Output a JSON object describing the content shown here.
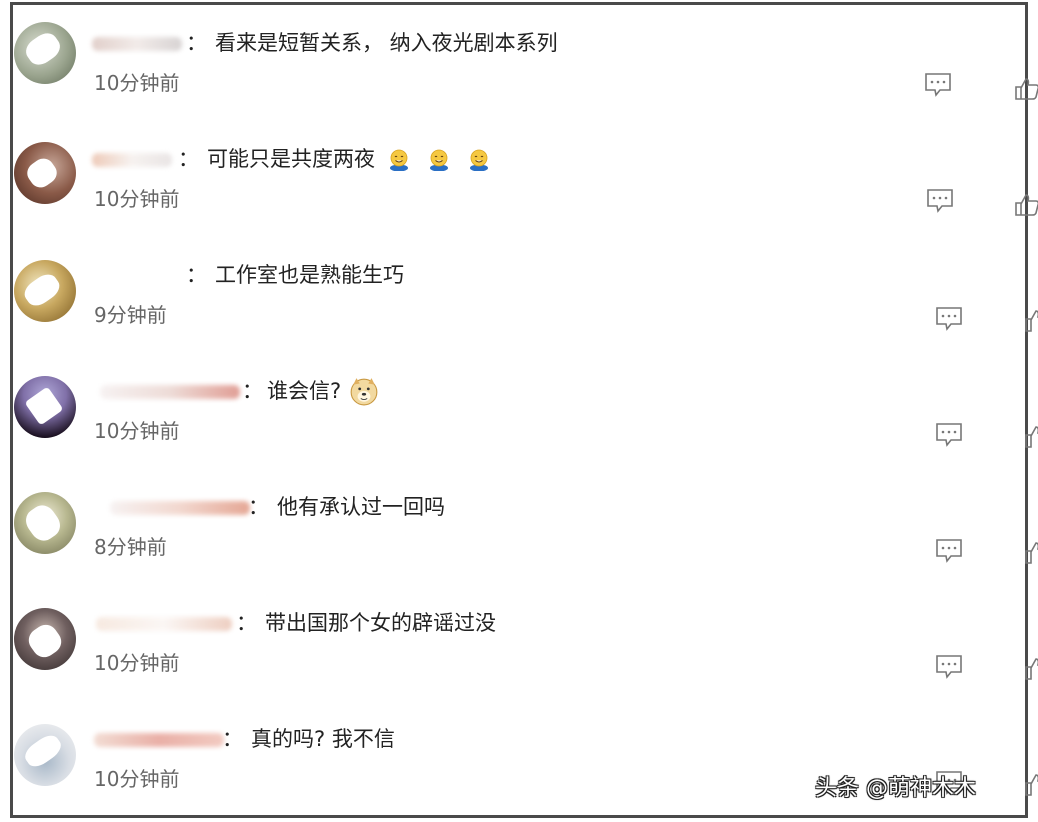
{
  "comments": [
    {
      "text": "看来是短暂关系， 纳入夜光剧本系列",
      "time": "10分钟前",
      "emojis": []
    },
    {
      "text": "可能只是共度两夜",
      "time": "10分钟前",
      "emojis": [
        "smile-emoji",
        "smile-emoji",
        "smile-emoji"
      ]
    },
    {
      "text": "工作室也是熟能生巧",
      "time": "9分钟前",
      "emojis": []
    },
    {
      "text": "谁会信?",
      "time": "10分钟前",
      "emojis": [
        "doge-emoji"
      ]
    },
    {
      "text": "他有承认过一回吗",
      "time": "8分钟前",
      "emojis": []
    },
    {
      "text": "带出国那个女的辟谣过没",
      "time": "10分钟前",
      "emojis": []
    },
    {
      "text": "真的吗? 我不信",
      "time": "10分钟前",
      "emojis": []
    }
  ],
  "colon": "：",
  "watermark": "头条 @萌神木木",
  "icons": {
    "reply": "comment-reply-icon",
    "like": "thumbs-up-icon"
  },
  "colors": {
    "text": "#222222",
    "time": "#666666",
    "icon": "#777777",
    "border": "#4a4a4a"
  }
}
